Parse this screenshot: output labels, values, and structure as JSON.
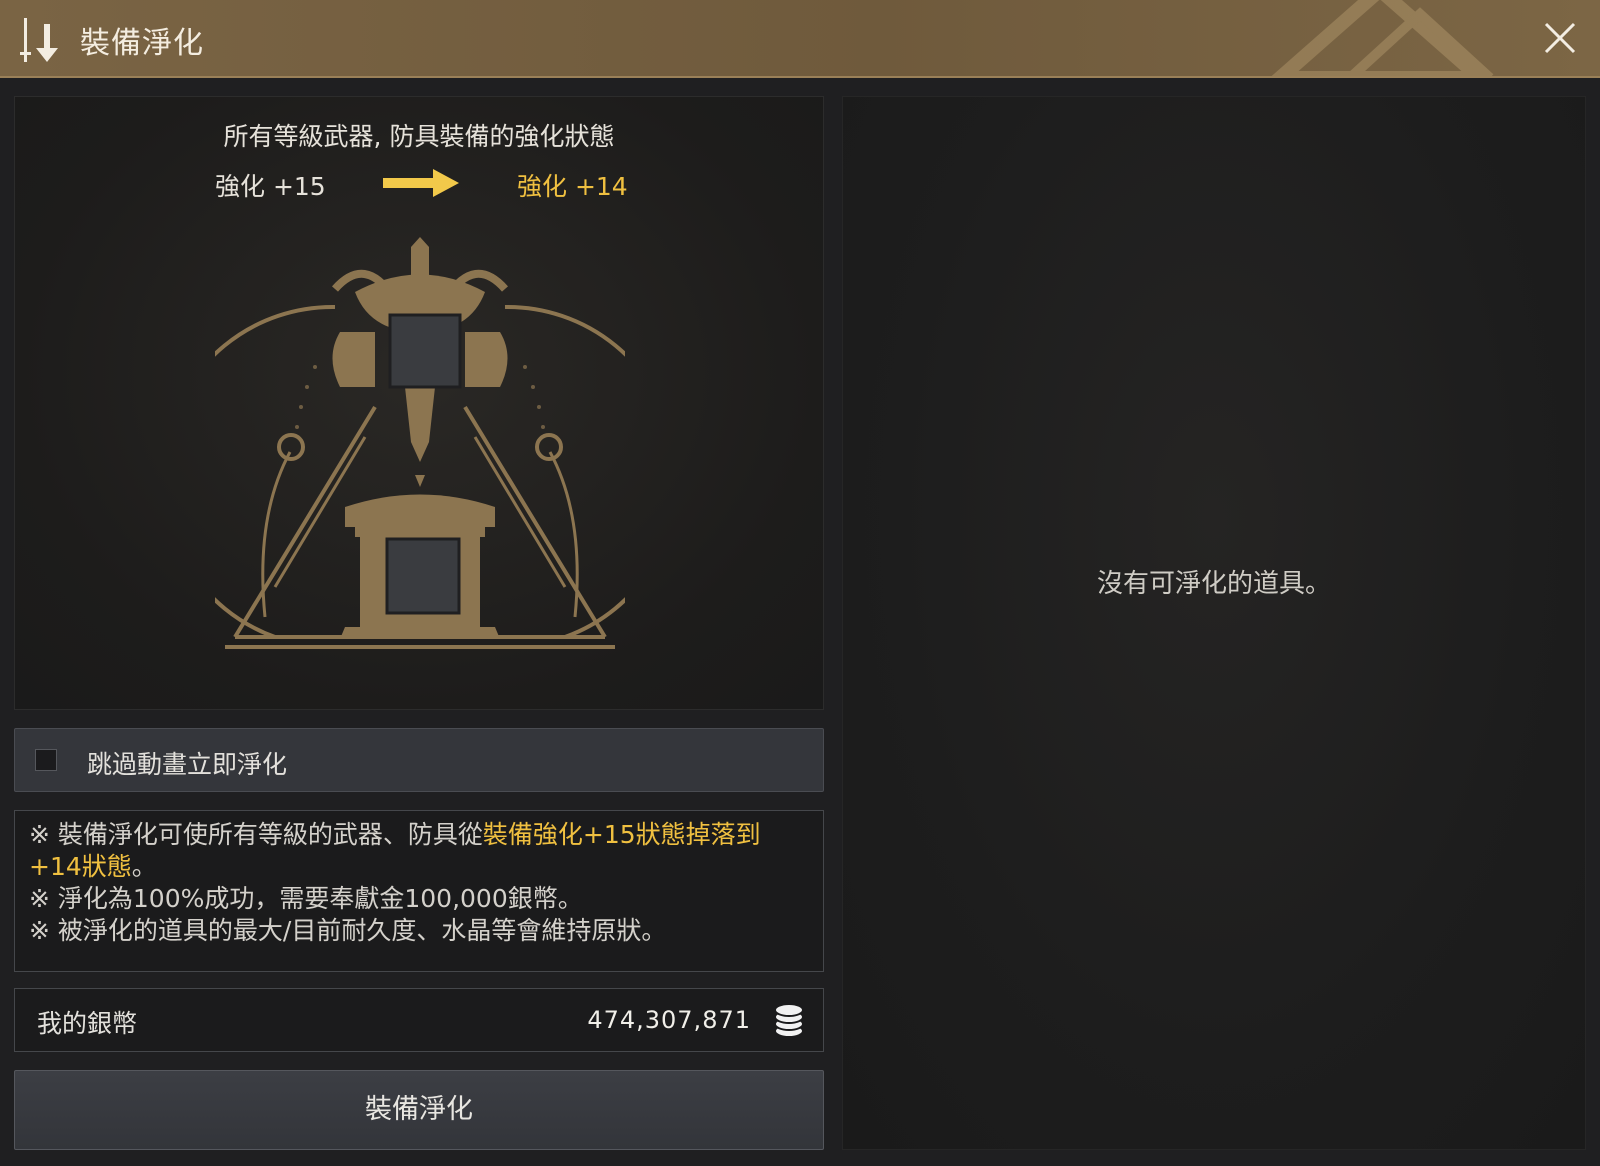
{
  "window": {
    "title": "裝備淨化"
  },
  "preview": {
    "heading": "所有等級武器, 防具裝備的強化狀態",
    "from_label": "強化 +15",
    "to_label": "強化 +14"
  },
  "options": {
    "skip_animation_label": "跳過動畫立即淨化",
    "skip_animation_checked": false
  },
  "notes": {
    "line1_prefix": "※ 裝備淨化可使所有等級的武器、防具從",
    "line1_highlight": "裝備強化+15狀態掉落到+14狀態",
    "line1_suffix": "。",
    "line2": "※ 淨化為100%成功，需要奉獻金100,000銀幣。",
    "line3": "※ 被淨化的道具的最大/目前耐久度、水晶等會維持原狀。"
  },
  "wallet": {
    "label": "我的銀幣",
    "amount": "474,307,871",
    "icon": "silver-coins-icon"
  },
  "actions": {
    "purify_label": "裝備淨化"
  },
  "item_list": {
    "empty_message": "沒有可淨化的道具。"
  },
  "colors": {
    "accent_gold": "#f0c040",
    "emblem_gold": "#8c7550",
    "titlebar": "#7a6444"
  }
}
